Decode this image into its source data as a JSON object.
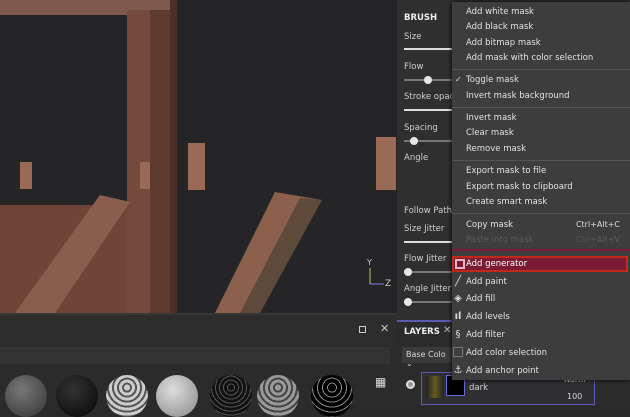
{
  "viewport": {
    "axis_y": "Y",
    "axis_z": "Z"
  },
  "brush": {
    "title": "BRUSH",
    "size": "Size",
    "flow": "Flow",
    "stroke_opacity": "Stroke opacit",
    "spacing": "Spacing",
    "angle": "Angle",
    "follow_path": "Follow Path",
    "size_jitter": "Size Jitter",
    "flow_jitter": "Flow Jitter",
    "angle_jitter": "Angle Jitter"
  },
  "layers": {
    "title": "LAYERS",
    "channel": "Base Colo",
    "layer_name": "dark",
    "blend": "Norm",
    "opacity": "100"
  },
  "menu": {
    "add_white_mask": "Add white mask",
    "add_black_mask": "Add black mask",
    "add_bitmap_mask": "Add bitmap mask",
    "add_mask_color": "Add mask with color selection",
    "toggle_mask": "Toggle mask",
    "invert_mask_bg": "Invert mask background",
    "invert_mask": "Invert mask",
    "clear_mask": "Clear mask",
    "remove_mask": "Remove mask",
    "export_file": "Export mask to file",
    "export_clipboard": "Export mask to clipboard",
    "create_smart": "Create smart mask",
    "copy_mask": "Copy mask",
    "copy_shortcut": "Ctrl+Alt+C",
    "paste_mask": "Paste into mask",
    "paste_shortcut": "Ctrl+Alt+V",
    "add_generator": "Add generator",
    "add_paint": "Add paint",
    "add_fill": "Add fill",
    "add_levels": "Add levels",
    "add_filter": "Add filter",
    "add_color_selection": "Add color selection",
    "add_anchor": "Add anchor point"
  },
  "colors": {
    "highlight": "#7a1a34",
    "highlight_border": "#c0281c",
    "accent": "#5a5ab0"
  }
}
